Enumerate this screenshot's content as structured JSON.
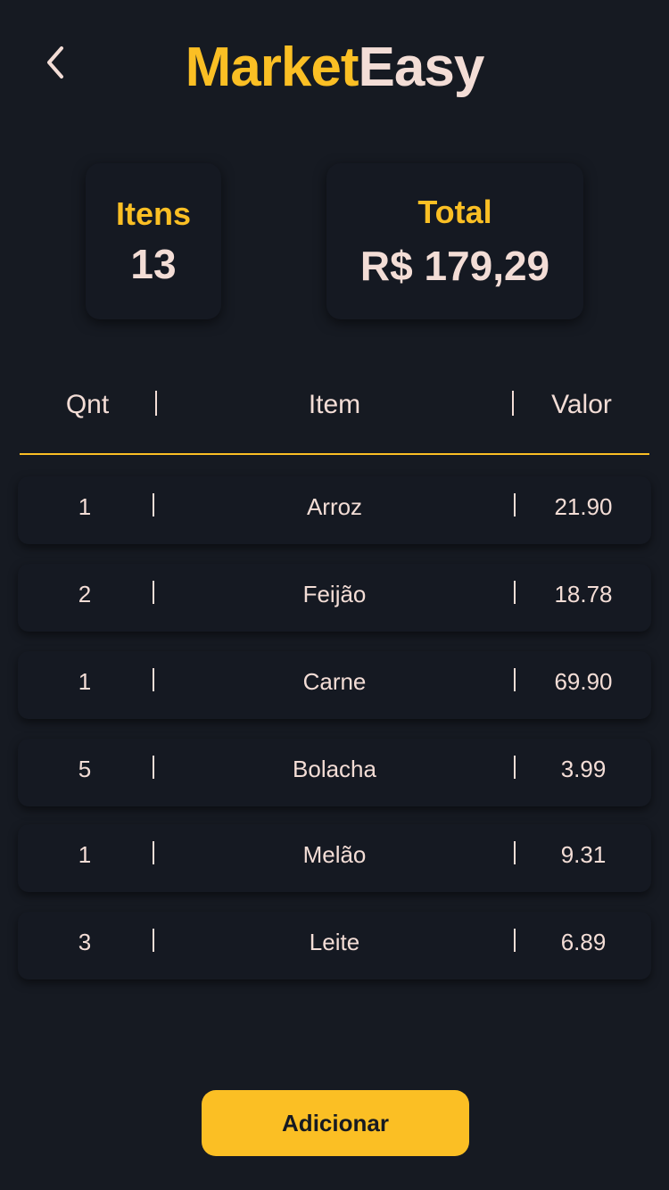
{
  "header": {
    "back_icon": "chevron-left-icon",
    "title_part1": "Market",
    "title_part2": "Easy"
  },
  "summary": {
    "items_label": "Itens",
    "items_value": "13",
    "total_label": "Total",
    "total_value": "R$ 179,29"
  },
  "table": {
    "headers": {
      "qnt": "Qnt",
      "item": "Item",
      "valor": "Valor"
    },
    "rows": [
      {
        "qnt": "1",
        "item": "Arroz",
        "valor": "21.90"
      },
      {
        "qnt": "2",
        "item": "Feijão",
        "valor": "18.78"
      },
      {
        "qnt": "1",
        "item": "Carne",
        "valor": "69.90"
      },
      {
        "qnt": "5",
        "item": "Bolacha",
        "valor": "3.99"
      },
      {
        "qnt": "1",
        "item": "Melão",
        "valor": "9.31"
      },
      {
        "qnt": "3",
        "item": "Leite",
        "valor": "6.89"
      }
    ]
  },
  "actions": {
    "add_label": "Adicionar"
  },
  "colors": {
    "background": "#161a22",
    "card": "#151922",
    "accent": "#fbbf24",
    "text": "#f3ddd6"
  }
}
